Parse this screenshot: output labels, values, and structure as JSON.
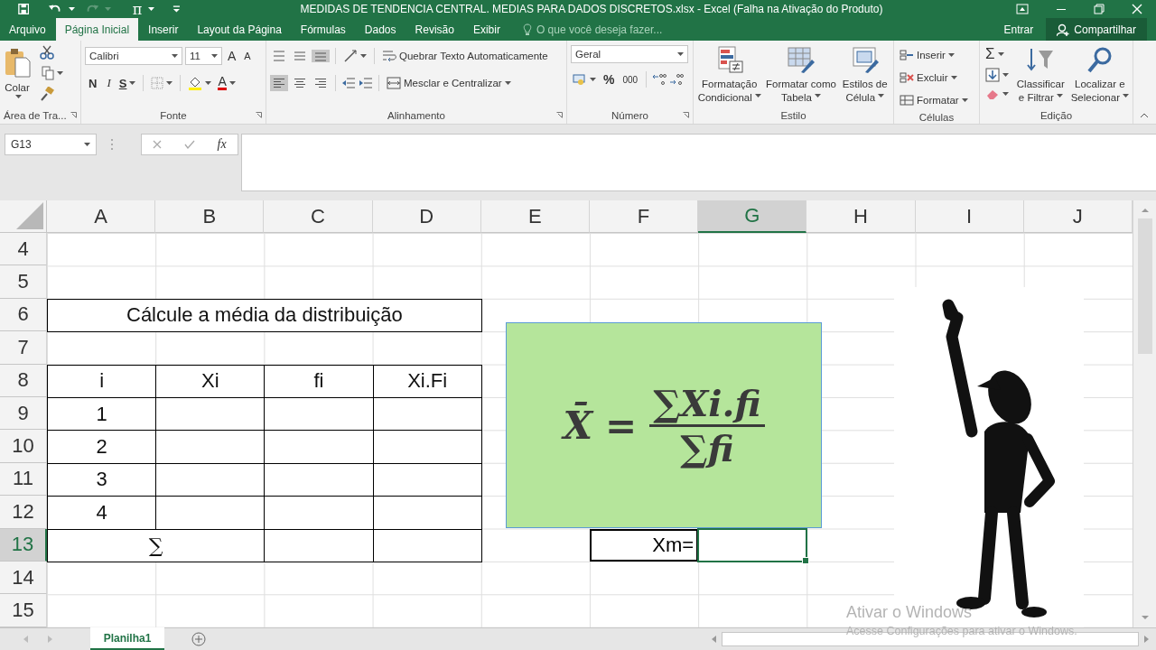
{
  "window": {
    "title": "MEDIDAS DE TENDENCIA CENTRAL. MEDIAS PARA DADOS DISCRETOS.xlsx - Excel (Falha na Ativação do Produto)",
    "equation_button": "π"
  },
  "ribbon_tabs": [
    {
      "label": "Arquivo",
      "selected": false
    },
    {
      "label": "Página Inicial",
      "selected": true
    },
    {
      "label": "Inserir",
      "selected": false
    },
    {
      "label": "Layout da Página",
      "selected": false
    },
    {
      "label": "Fórmulas",
      "selected": false
    },
    {
      "label": "Dados",
      "selected": false
    },
    {
      "label": "Revisão",
      "selected": false
    },
    {
      "label": "Exibir",
      "selected": false
    }
  ],
  "tell_me": {
    "placeholder": "O que você deseja fazer..."
  },
  "account": {
    "sign_in": "Entrar",
    "share": "Compartilhar"
  },
  "ribbon": {
    "clipboard": {
      "paste": "Colar",
      "label": "Área de Tra..."
    },
    "font": {
      "name": "Calibri",
      "size": "11",
      "grow": "A",
      "shrink": "A",
      "bold": "N",
      "italic": "I",
      "underline": "S",
      "color_button": "A",
      "label": "Fonte"
    },
    "alignment": {
      "vertical": [
        {
          "kind": "top",
          "selected": false
        },
        {
          "kind": "middle",
          "selected": false
        },
        {
          "kind": "bottom",
          "selected": true
        }
      ],
      "horizontal": [
        {
          "kind": "left",
          "selected": true
        },
        {
          "kind": "center",
          "selected": false
        },
        {
          "kind": "right",
          "selected": false
        }
      ],
      "wrap": "Quebrar Texto Automaticamente",
      "merge": "Mesclar e Centralizar",
      "label": "Alinhamento"
    },
    "number": {
      "format": "Geral",
      "percent": "%",
      "thousands": "000",
      "label": "Número"
    },
    "styles": {
      "buttons": [
        {
          "kind": "conditional",
          "label": "Formatação Condicional"
        },
        {
          "kind": "table",
          "label": "Formatar como Tabela"
        },
        {
          "kind": "cell",
          "label": "Estilos de Célula"
        }
      ],
      "label": "Estilo"
    },
    "cells": {
      "buttons": [
        {
          "kind": "insert",
          "label": "Inserir"
        },
        {
          "kind": "delete",
          "label": "Excluir"
        },
        {
          "kind": "format",
          "label": "Formatar"
        }
      ],
      "label": "Células"
    },
    "editing": {
      "autosum": "Σ",
      "buttons": [
        {
          "kind": "sort",
          "label": "Classificar e Filtrar"
        },
        {
          "kind": "find",
          "label": "Localizar e Selecionar"
        }
      ],
      "label": "Edição"
    }
  },
  "formula_bar": {
    "name_box": "G13",
    "insert_function": "fx"
  },
  "sheet": {
    "columns": [
      {
        "label": "A",
        "selected": false
      },
      {
        "label": "B",
        "selected": false
      },
      {
        "label": "C",
        "selected": false
      },
      {
        "label": "D",
        "selected": false
      },
      {
        "label": "E",
        "selected": false
      },
      {
        "label": "F",
        "selected": false
      },
      {
        "label": "G",
        "selected": true
      },
      {
        "label": "H",
        "selected": false
      },
      {
        "label": "I",
        "selected": false
      },
      {
        "label": "J",
        "selected": false
      }
    ],
    "rows": [
      {
        "label": "4",
        "selected": false
      },
      {
        "label": "5",
        "selected": false
      },
      {
        "label": "6",
        "selected": false
      },
      {
        "label": "7",
        "selected": false
      },
      {
        "label": "8",
        "selected": false
      },
      {
        "label": "9",
        "selected": false
      },
      {
        "label": "10",
        "selected": false
      },
      {
        "label": "11",
        "selected": false
      },
      {
        "label": "12",
        "selected": false
      },
      {
        "label": "13",
        "selected": true
      },
      {
        "label": "14",
        "selected": false
      },
      {
        "label": "15",
        "selected": false
      }
    ],
    "title": "Cálcule a média da distribuição",
    "table": {
      "columns": [
        "i",
        "Xi",
        "fi",
        "Xi.Fi"
      ],
      "rows": [
        "1",
        "2",
        "3",
        "4"
      ],
      "total": "∑"
    },
    "result_label": "Xm=",
    "formula_image": {
      "variable": "X̄",
      "equals": "=",
      "numerator": "∑Xi.fi",
      "denominator": "∑fi"
    }
  },
  "sheet_tabs": [
    {
      "label": "Planilha1",
      "selected": true
    }
  ],
  "activation_notice": {
    "title": "Ativar o Windows",
    "message": "Acesse Configurações para ativar o Windows."
  }
}
